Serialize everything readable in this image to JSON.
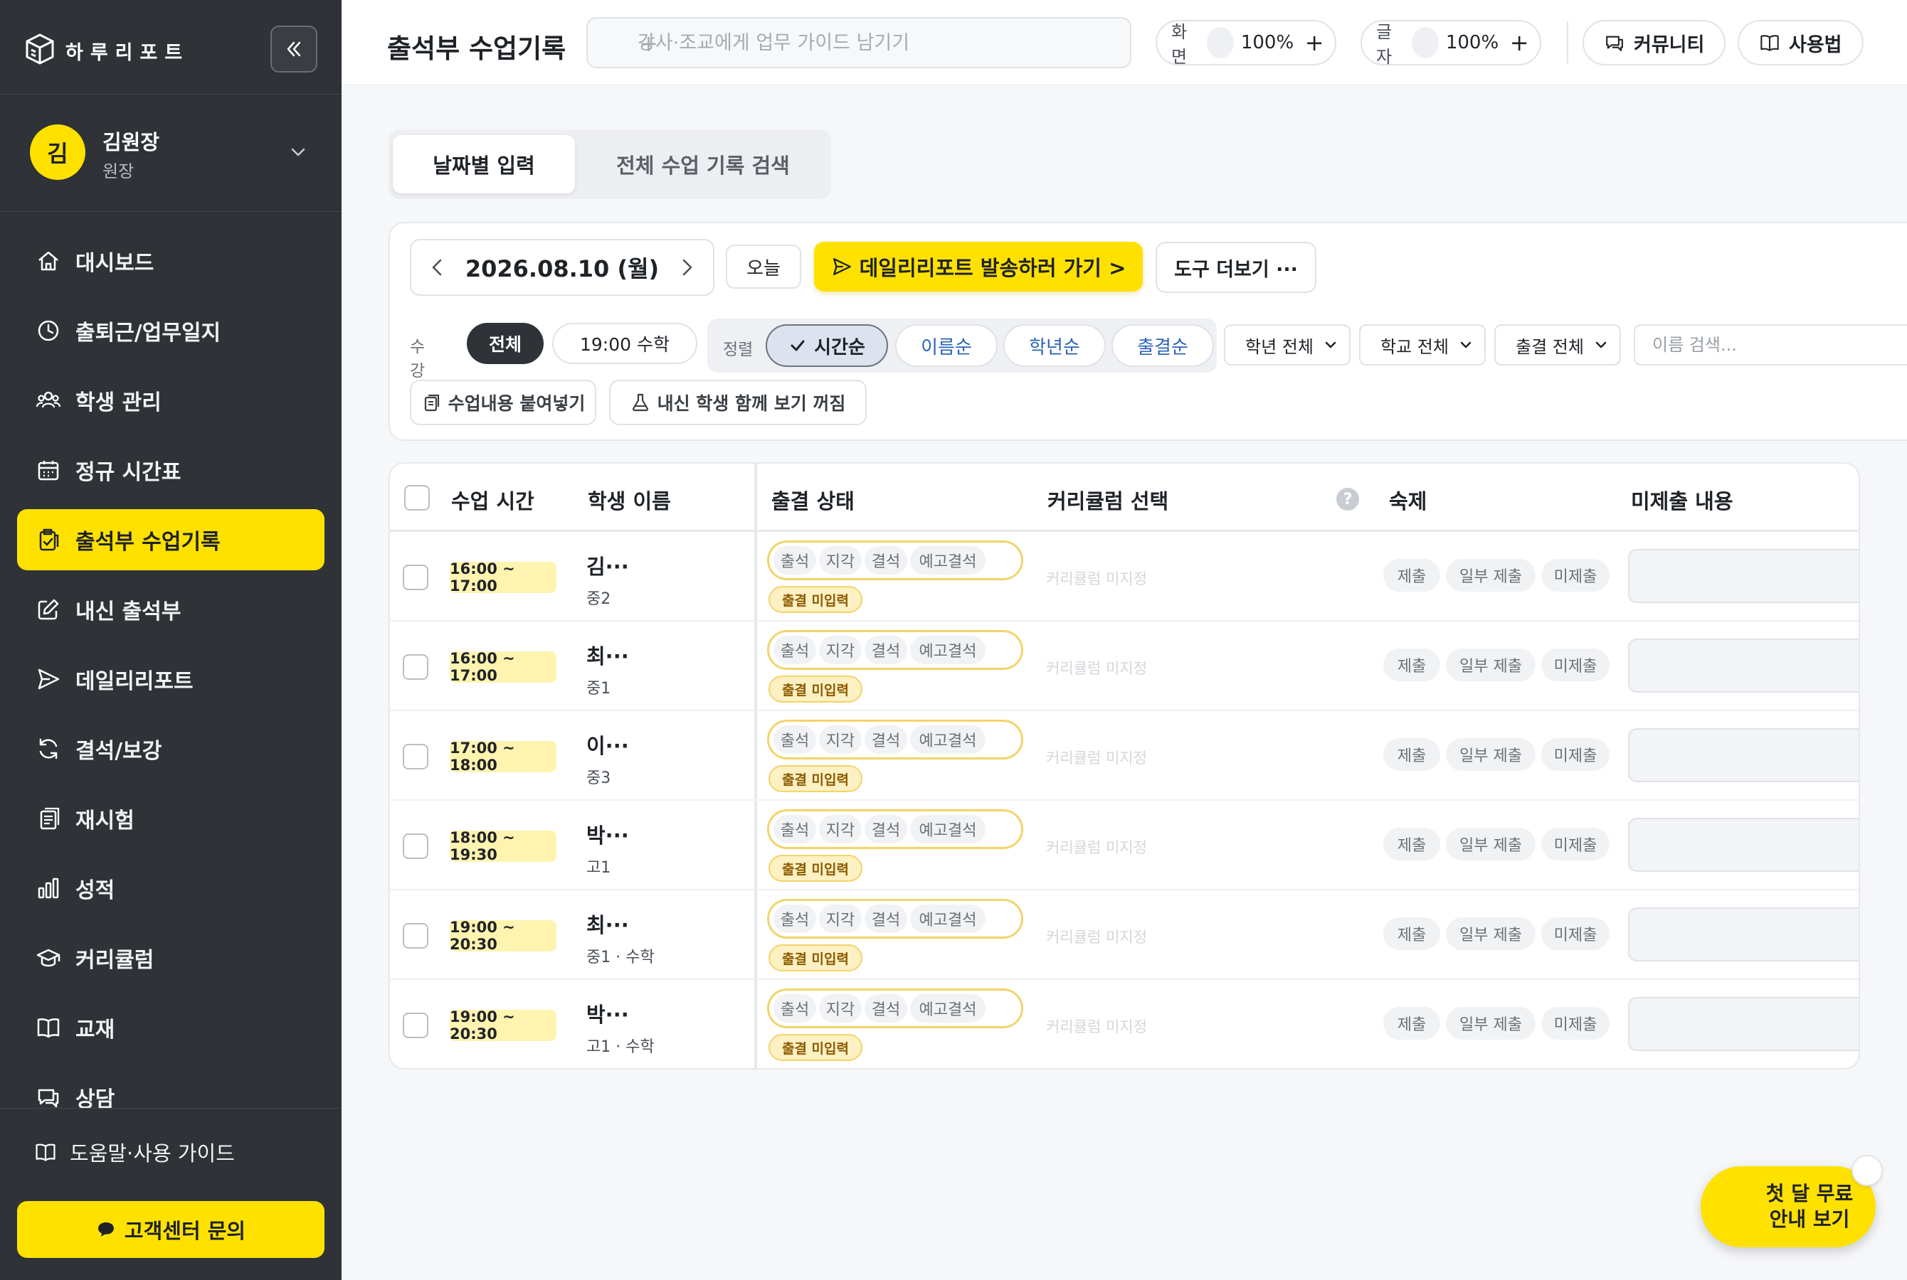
{
  "brand": {
    "name": "하루리포트"
  },
  "profile": {
    "avatar_initial": "김",
    "name": "김원장",
    "role": "원장"
  },
  "nav": {
    "items": [
      {
        "label": "대시보드",
        "icon": "home-icon"
      },
      {
        "label": "출퇴근/업무일지",
        "icon": "clock-icon"
      },
      {
        "label": "학생 관리",
        "icon": "users-icon"
      },
      {
        "label": "정규 시간표",
        "icon": "calendar-icon"
      },
      {
        "label": "출석부 수업기록",
        "icon": "clipboard-check-icon",
        "active": true
      },
      {
        "label": "내신 출석부",
        "icon": "edit-icon"
      },
      {
        "label": "데일리리포트",
        "icon": "send-icon"
      },
      {
        "label": "결석/보강",
        "icon": "refresh-icon"
      },
      {
        "label": "재시험",
        "icon": "document-icon"
      },
      {
        "label": "성적",
        "icon": "bar-chart-icon"
      },
      {
        "label": "커리큘럼",
        "icon": "graduation-cap-icon"
      },
      {
        "label": "교재",
        "icon": "book-icon"
      },
      {
        "label": "상담",
        "icon": "chat-icon"
      }
    ]
  },
  "sidebar_bottom": {
    "help_label": "도움말·사용 가이드",
    "support_label": "고객센터 문의"
  },
  "topbar": {
    "title": "출석부 수업기록",
    "guide_placeholder": "강사·조교에게 업무 가이드 남기기",
    "screen_label": "화면",
    "screen_zoom": "100%",
    "font_label": "글자",
    "font_zoom": "100%",
    "community_label": "커뮤니티",
    "manual_label": "사용법"
  },
  "tabs": [
    {
      "label": "날짜별 입력",
      "active": true
    },
    {
      "label": "전체 수업 기록 검색",
      "active": false
    }
  ],
  "filters": {
    "date": "2026.08.10 (월)",
    "today_label": "오늘",
    "report_button": "데일리리포트 발송하러 가기 >",
    "tools_button": "도구 더보기 ···",
    "class_label": "수강반",
    "class_chips": [
      "전체",
      "19:00 수학"
    ],
    "sort_label": "정렬",
    "sort_options": [
      "시간순",
      "이름순",
      "학년순",
      "출결순"
    ],
    "sort_active": "시간순",
    "grade_select": "학년 전체",
    "school_select": "학교 전체",
    "attendance_select": "출결 전체",
    "name_placeholder": "이름 검색...",
    "paste_button": "수업내용 붙여넣기",
    "school_toggle_button": "내신 학생 함께 보기 꺼짐"
  },
  "table": {
    "headers": {
      "time": "수업 시간",
      "name": "학생 이름",
      "attendance": "출결 상태",
      "curriculum": "커리큘럼 선택",
      "homework": "숙제",
      "missing": "미제출 내용"
    },
    "attendance_options": [
      "출석",
      "지각",
      "결석",
      "예고결석"
    ],
    "homework_options": [
      "제출",
      "일부 제출",
      "미제출"
    ],
    "rows": [
      {
        "time": "16:00 ~ 17:00",
        "name": "김···",
        "grade": "중2",
        "status": "출결 미입력",
        "curriculum": "커리큘럼 미지정"
      },
      {
        "time": "16:00 ~ 17:00",
        "name": "최···",
        "grade": "중1",
        "status": "출결 미입력",
        "curriculum": "커리큘럼 미지정"
      },
      {
        "time": "17:00 ~ 18:00",
        "name": "이···",
        "grade": "중3",
        "status": "출결 미입력",
        "curriculum": "커리큘럼 미지정"
      },
      {
        "time": "18:00 ~ 19:30",
        "name": "박···",
        "grade": "고1",
        "status": "출결 미입력",
        "curriculum": "커리큘럼 미지정"
      },
      {
        "time": "19:00 ~ 20:30",
        "name": "최···",
        "grade": "중1 · 수학",
        "status": "출결 미입력",
        "curriculum": "커리큘럼 미지정"
      },
      {
        "time": "19:00 ~ 20:30",
        "name": "박···",
        "grade": "고1 · 수학",
        "status": "출결 미입력",
        "curriculum": "커리큘럼 미지정"
      }
    ]
  },
  "promo": {
    "line1": "첫 달 무료",
    "line2": "안내 보기"
  },
  "colors": {
    "accent": "#ffe100",
    "sidebar": "#2f3236",
    "badge_bg": "#fff3b0",
    "status_border": "#f2d46a"
  }
}
